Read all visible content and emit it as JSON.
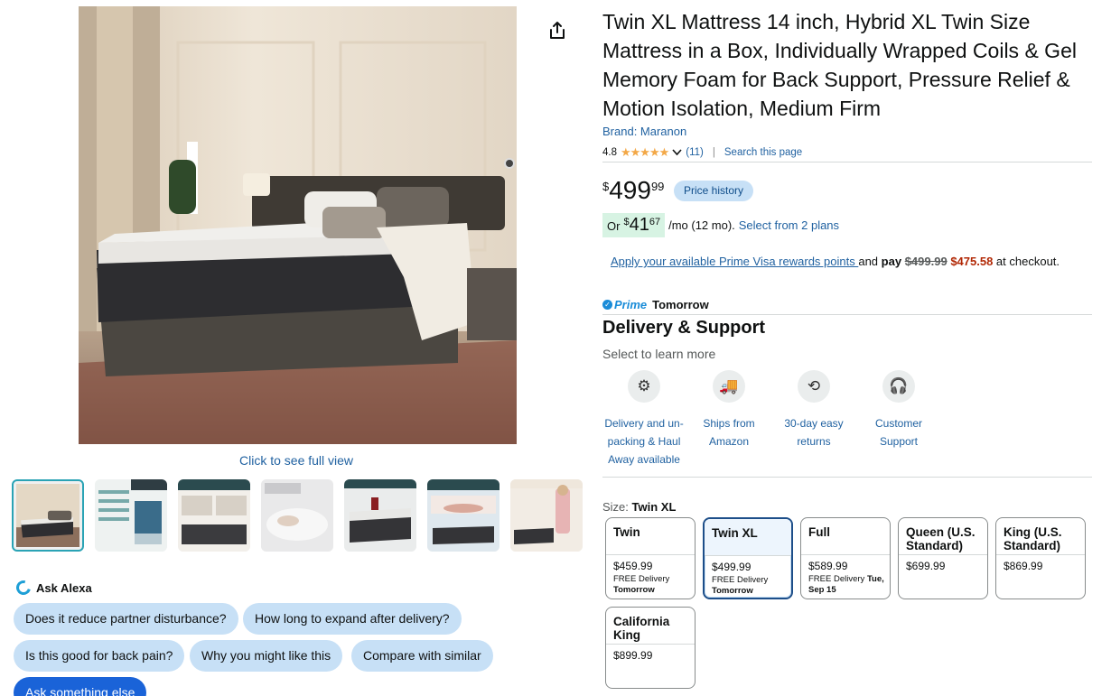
{
  "gallery": {
    "full_view_label": "Click to see full view",
    "thumbnails": [
      {
        "caption": ""
      },
      {
        "caption": "EXPLORE THE INNOVATIVE STRUCTURE"
      },
      {
        "caption": "BEST SETTLING FOR LOW COST ALTERNATIVE"
      },
      {
        "caption": "BREATHABLE FABRIC FOR A COOLER DEEPER SLEEP"
      },
      {
        "caption": "INDIVIDUAL POCKET SPRINGS SILENT SPRING SUPPORT"
      },
      {
        "caption": "ZONE-ENGINEERED FOR SPINAL ALIGNMENT"
      },
      {
        "caption": "EASY & FAST SET UP"
      }
    ]
  },
  "alexa": {
    "title": "Ask Alexa",
    "chips": [
      "Does it reduce partner disturbance?",
      "How long to expand after delivery?",
      "Is this good for back pain?",
      "Why you might like this",
      "Compare with similar",
      "Ask something else"
    ]
  },
  "product": {
    "title": "Twin XL Mattress 14 inch, Hybrid XL Twin Size Mattress in a Box, Individually Wrapped Coils & Gel Memory Foam for Back Support, Pressure Relief & Motion Isolation, Medium Firm",
    "brand": "Brand: Maranon",
    "rating": "4.8",
    "stars": "★★★★★",
    "review_count": "(11)",
    "search_page": "Search this page"
  },
  "price": {
    "currency": "$",
    "whole": "499",
    "fraction": "99",
    "history_label": "Price history",
    "monthly": {
      "prefix": "Or",
      "currency": "$",
      "whole": "41",
      "fraction": "67",
      "suffix": "/mo (12 mo).",
      "plans_link": "Select from 2 plans"
    }
  },
  "prime_visa": {
    "link": "Apply your available Prime Visa rewards points ",
    "mid": "and ",
    "pay": "pay",
    "old_price": "$499.99",
    "new_price": "$475.58",
    "end": " at checkout."
  },
  "prime": {
    "logo_text": "Prime",
    "delivery": "Tomorrow"
  },
  "delivery_support": {
    "title": "Delivery & Support",
    "subtitle": "Select to learn more",
    "features": [
      {
        "icon": "gear-wrench-icon",
        "glyph": "⚙",
        "label": "Delivery and un-packing & Haul Away available"
      },
      {
        "icon": "truck-icon",
        "glyph": "🚚",
        "label": "Ships from Amazon"
      },
      {
        "icon": "return-box-icon",
        "glyph": "⟲",
        "label": "30-day easy returns"
      },
      {
        "icon": "headset-icon",
        "glyph": "🎧",
        "label": "Customer Support"
      }
    ]
  },
  "size": {
    "label": "Size: ",
    "selected": "Twin XL",
    "options": [
      {
        "name": "Twin",
        "price": "$459.99",
        "delivery": "FREE Delivery",
        "when": "Tomorrow"
      },
      {
        "name": "Twin XL",
        "price": "$499.99",
        "delivery": "FREE Delivery",
        "when": "Tomorrow"
      },
      {
        "name": "Full",
        "price": "$589.99",
        "delivery": "FREE Delivery ",
        "when": "Tue, Sep 15"
      },
      {
        "name": "Queen (U.S. Standard)",
        "price": "$699.99",
        "delivery": "",
        "when": ""
      },
      {
        "name": "King (U.S. Standard)",
        "price": "$869.99",
        "delivery": "",
        "when": ""
      },
      {
        "name": "California King",
        "price": "$899.99",
        "delivery": "",
        "when": ""
      }
    ]
  },
  "colors": {
    "link": "#2162a1",
    "price_red": "#b12704",
    "chip_bg": "#c7e0f6",
    "prime_blue": "#1a8cd8",
    "star": "#f3a847"
  }
}
